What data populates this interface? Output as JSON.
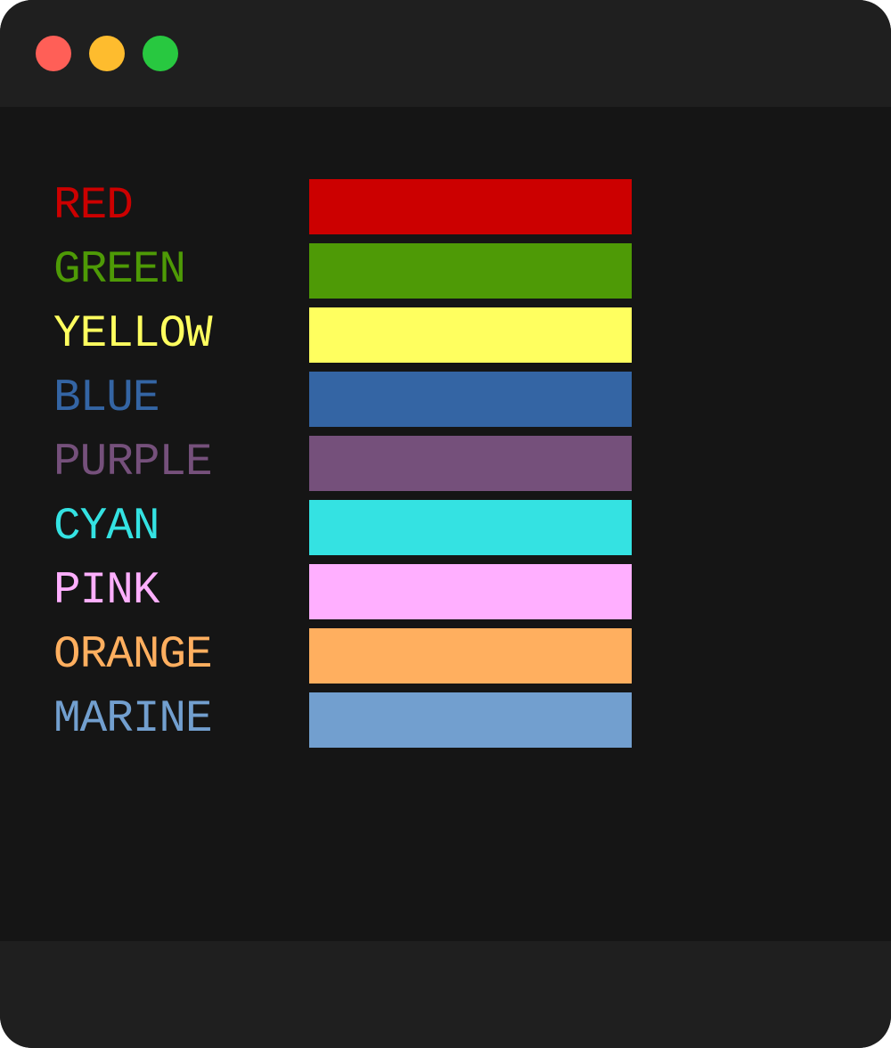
{
  "window": {
    "controls": [
      {
        "name": "close",
        "color": "#ff5f57"
      },
      {
        "name": "minimize",
        "color": "#febc2e"
      },
      {
        "name": "maximize",
        "color": "#28c840"
      }
    ]
  },
  "colors": [
    {
      "label": "RED",
      "text_color": "#cc0000",
      "swatch_color": "#cc0000"
    },
    {
      "label": "GREEN",
      "text_color": "#4e9a06",
      "swatch_color": "#4e9a06"
    },
    {
      "label": "YELLOW",
      "text_color": "#ffff5f",
      "swatch_color": "#ffff5f"
    },
    {
      "label": "BLUE",
      "text_color": "#3465a4",
      "swatch_color": "#3465a4"
    },
    {
      "label": "PURPLE",
      "text_color": "#75507b",
      "swatch_color": "#75507b"
    },
    {
      "label": "CYAN",
      "text_color": "#34e2e2",
      "swatch_color": "#34e2e2"
    },
    {
      "label": "PINK",
      "text_color": "#ffafff",
      "swatch_color": "#ffafff"
    },
    {
      "label": "ORANGE",
      "text_color": "#ffaf5f",
      "swatch_color": "#ffaf5f"
    },
    {
      "label": "MARINE",
      "text_color": "#729fcf",
      "swatch_color": "#729fcf"
    }
  ]
}
